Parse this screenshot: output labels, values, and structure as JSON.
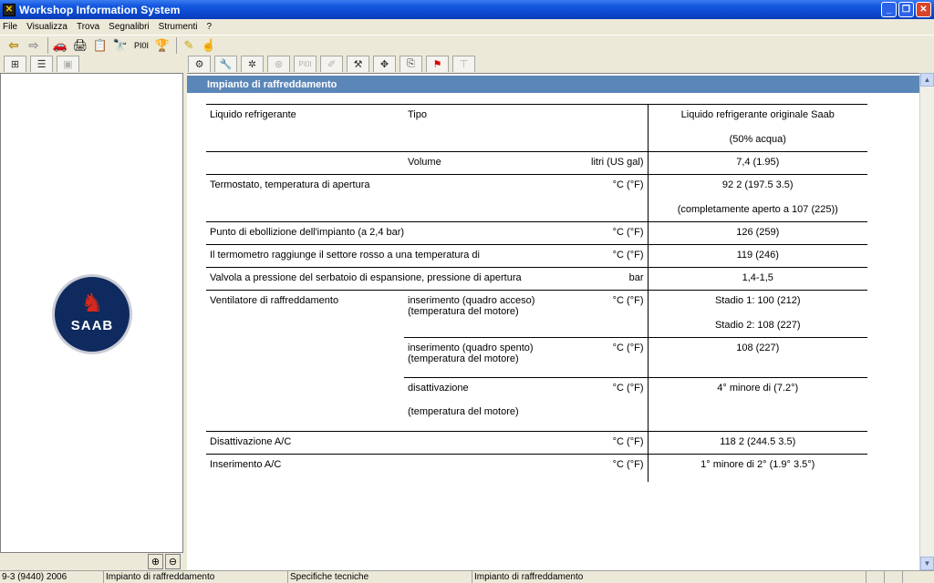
{
  "window": {
    "title": "Workshop Information System"
  },
  "menu": [
    "File",
    "Visualizza",
    "Trova",
    "Segnalibri",
    "Strumenti",
    "?"
  ],
  "toolbar": {
    "icons": [
      "arrow-left-icon",
      "arrow-right-icon",
      "car-icon",
      "printer-icon",
      "document-search-icon",
      "binoculars-icon",
      "pi-icon",
      "cup-icon",
      "pencil-icon",
      "pointer-icon"
    ],
    "pi_label": "PI0I"
  },
  "subbar": {
    "pi_label": "PI0I"
  },
  "content": {
    "header": "Impianto di raffreddamento",
    "rows": [
      {
        "c1": "Liquido refrigerante",
        "c2": "Tipo",
        "c3": "",
        "c4": "Liquido refrigerante originale Saab",
        "c4b": "(50% acqua)"
      },
      {
        "c1": "",
        "c2": "Volume",
        "c3": "litri (US gal)",
        "c4": "7,4 (1.95)",
        "c4b": ""
      },
      {
        "c1": "Termostato, temperatura di apertura",
        "c2": "",
        "c3": "°C (°F)",
        "c4": "92 2 (197.5 3.5)",
        "c4b": "(completamente aperto a 107 (225))"
      },
      {
        "c1": "Punto di ebollizione dell'impianto (a 2,4 bar)",
        "c2": "",
        "c3": "°C (°F)",
        "c4": "126 (259)",
        "c4b": ""
      },
      {
        "c1": "Il termometro raggiunge il settore rosso a una temperatura di",
        "c2": "",
        "c3": "°C (°F)",
        "c4": "119 (246)",
        "c4b": ""
      },
      {
        "c1": "Valvola a pressione del serbatoio di espansione, pressione di apertura",
        "c2": "",
        "c3": "bar",
        "c4": "1,4-1,5",
        "c4b": ""
      },
      {
        "c1": "Ventilatore di raffreddamento",
        "c2": "inserimento (quadro acceso)",
        "c2b": "(temperatura del motore)",
        "c3": "°C (°F)",
        "c4": "Stadio 1: 100 (212)",
        "c4b": "Stadio 2: 108 (227)"
      },
      {
        "c1": "",
        "c2": "inserimento (quadro spento)",
        "c2b": "(temperatura del motore)",
        "c3": "°C (°F)",
        "c4": "108 (227)",
        "c4b": ""
      },
      {
        "c1": "",
        "c2": "disattivazione",
        "c2c": "(temperatura del motore)",
        "c3": "°C (°F)",
        "c4": "4° minore di (7.2°)",
        "c4b": ""
      },
      {
        "c1": "Disattivazione A/C",
        "c2": "",
        "c3": "°C (°F)",
        "c4": "118 2 (244.5 3.5)",
        "c4b": ""
      },
      {
        "c1": "Inserimento A/C",
        "c2": "",
        "c3": "°C (°F)",
        "c4": "1° minore di 2° (1.9° 3.5°)",
        "c4b": ""
      }
    ]
  },
  "statusbar": [
    "9-3 (9440) 2006",
    "Impianto di raffreddamento",
    "Specifiche tecniche",
    "Impianto di raffreddamento"
  ]
}
